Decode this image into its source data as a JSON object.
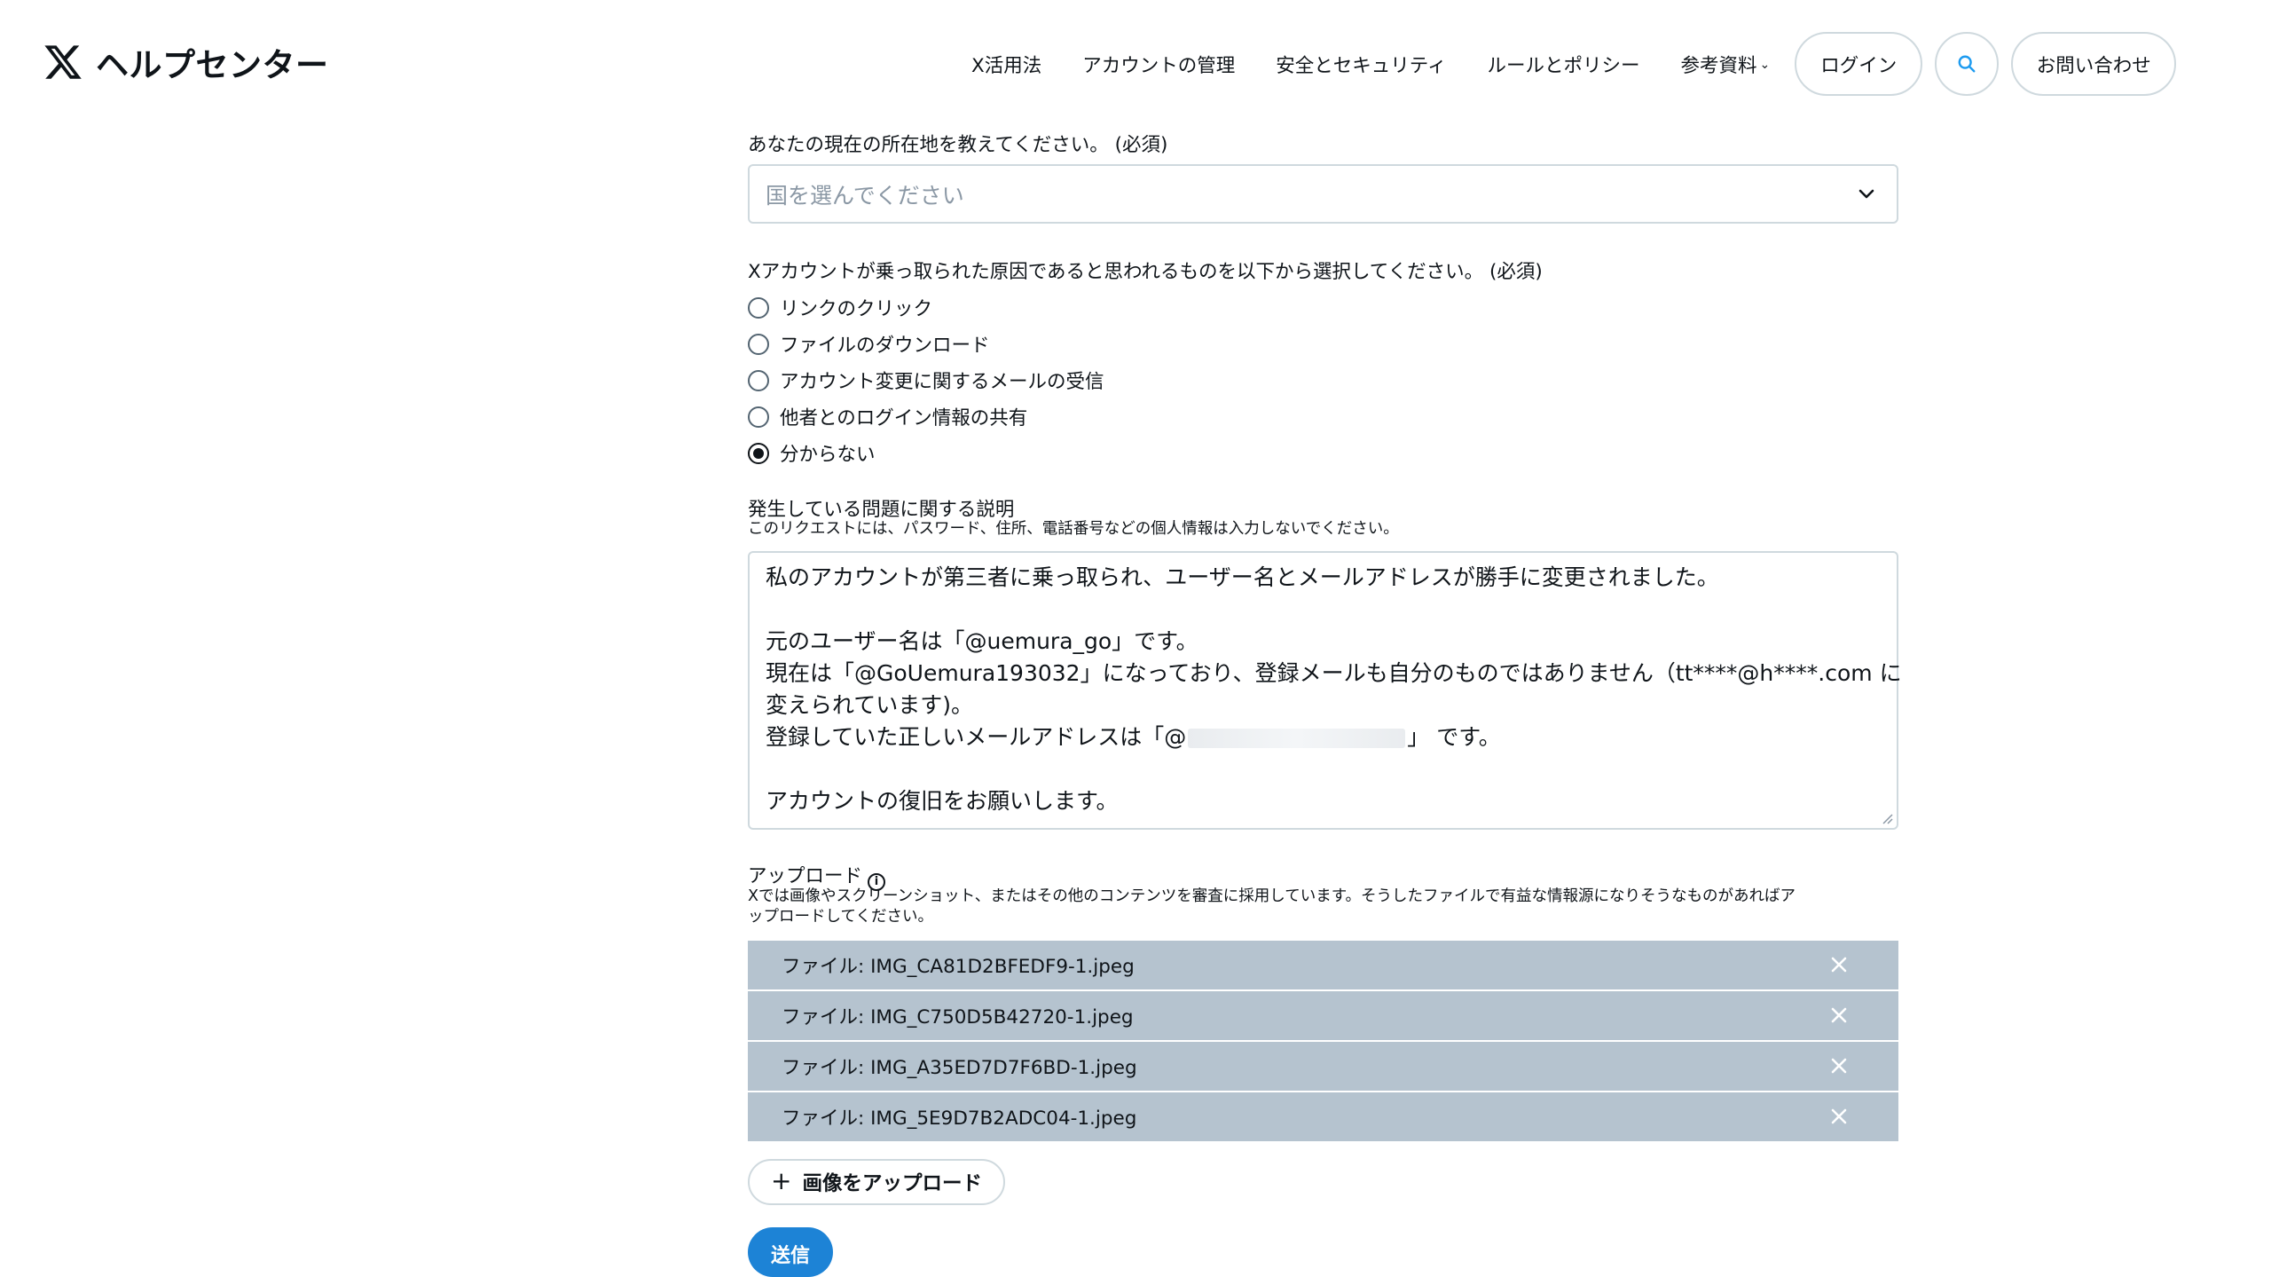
{
  "header": {
    "brand_title": "ヘルプセンター",
    "nav": [
      "X活用法",
      "アカウントの管理",
      "安全とセキュリティ",
      "ルールとポリシー",
      "参考資料"
    ],
    "login_label": "ログイン",
    "contact_label": "お問い合わせ"
  },
  "form": {
    "location": {
      "label": "あなたの現在の所在地を教えてください。 (必須)",
      "placeholder": "国を選んでください"
    },
    "cause": {
      "label": "Xアカウントが乗っ取られた原因であると思われるものを以下から選択してください。 (必須)",
      "options": [
        "リンクのクリック",
        "ファイルのダウンロード",
        "アカウント変更に関するメールの受信",
        "他者とのログイン情報の共有",
        "分からない"
      ],
      "selected": "分からない"
    },
    "description": {
      "label": "発生している問題に関する説明",
      "note": "このリクエストには、パスワード、住所、電話番号などの個人情報は入力しないでください。",
      "lines": [
        "私のアカウントが第三者に乗っ取られ、ユーザー名とメールアドレスが勝手に変更されました。",
        "",
        "元のユーザー名は「@uemura_go」です。",
        "現在は「@GoUemura193032」になっており、登録メールも自分のものではありません（tt****@h****.com に",
        "変えられています)。",
        "登録していた正しいメールアドレスは「@",
        "」 です。",
        "",
        "アカウントの復旧をお願いします。"
      ]
    },
    "upload": {
      "label": "アップロード",
      "note_line1": "Xでは画像やスクリーンショット、またはその他のコンテンツを審査に採用しています。そうしたファイルで有益な情報源になりそうなものがあればア",
      "note_line2": "ップロードしてください。",
      "files": [
        "ファイル: IMG_CA81D2BFEDF9-1.jpeg",
        "ファイル: IMG_C750D5B42720-1.jpeg",
        "ファイル: IMG_A35ED7D7F6BD-1.jpeg",
        "ファイル: IMG_5E9D7B2ADC04-1.jpeg"
      ],
      "button_label": "画像をアップロード"
    },
    "submit_label": "送信"
  }
}
